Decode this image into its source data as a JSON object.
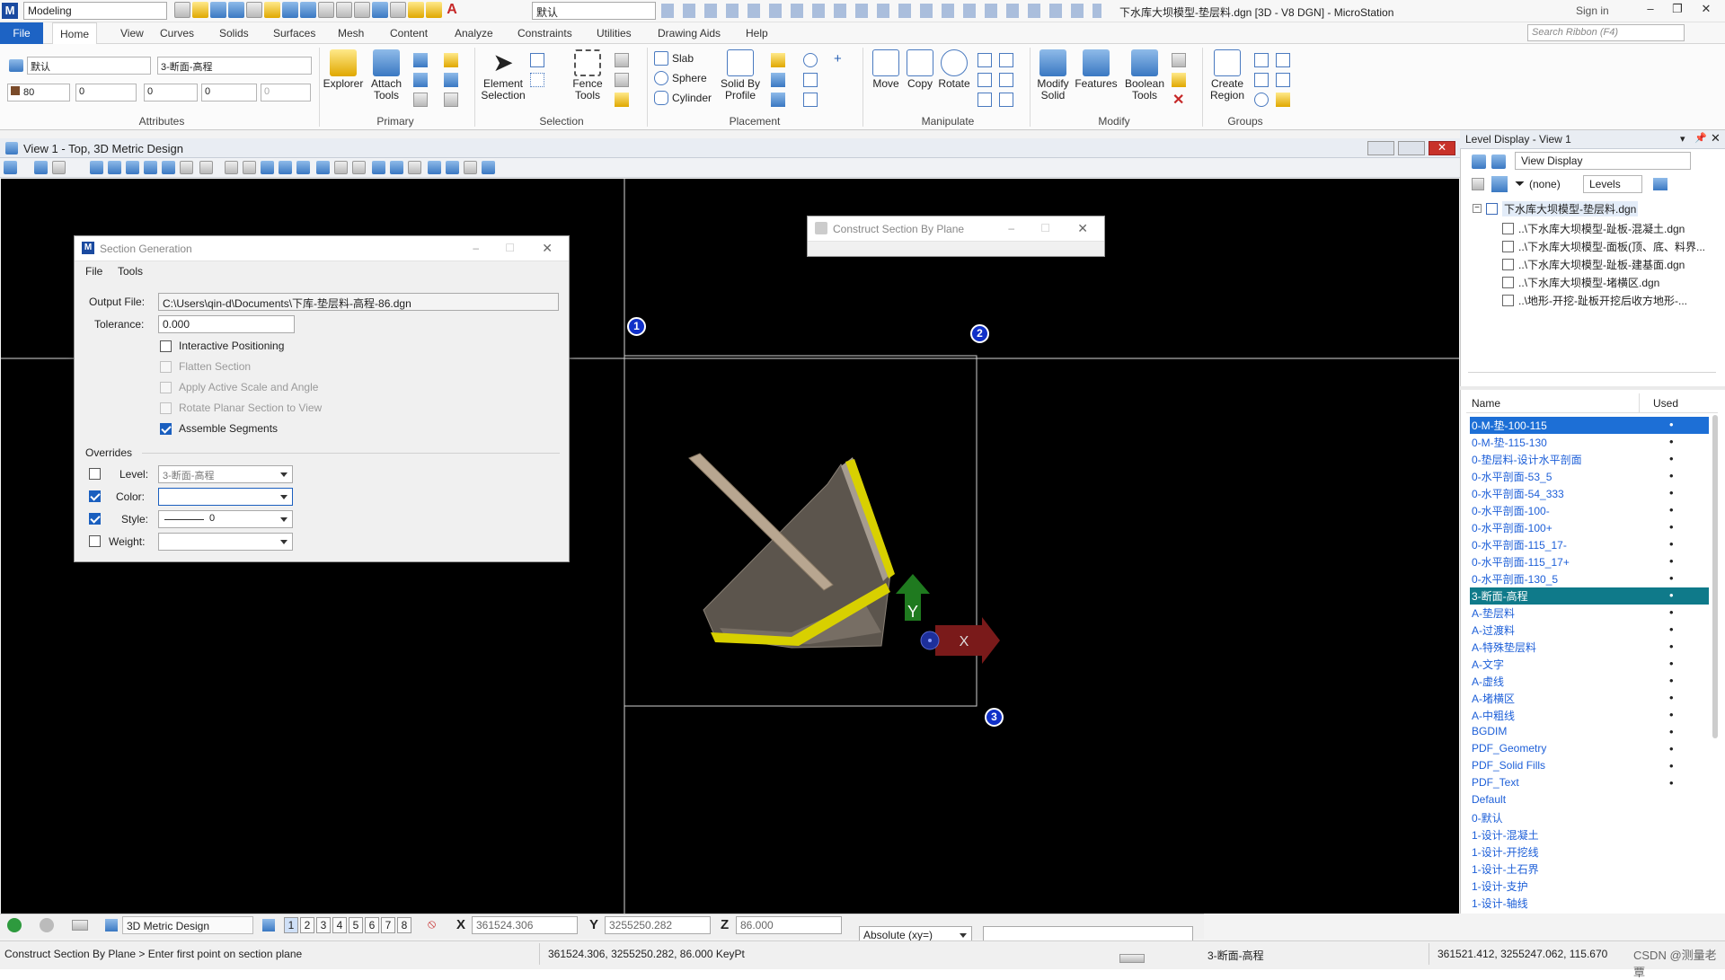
{
  "app": {
    "workspace": "Modeling",
    "active_style": "默认",
    "title": "下水库大坝模型-垫层料.dgn [3D - V8 DGN] - MicroStation",
    "signin": "Sign in"
  },
  "ribbon": {
    "tabs": [
      "File",
      "Home",
      "View",
      "Curves",
      "Solids",
      "Surfaces",
      "Mesh",
      "Content",
      "Analyze",
      "Constraints",
      "Utilities",
      "Drawing Aids",
      "Help"
    ],
    "search_placeholder": "Search Ribbon (F4)",
    "attributes": {
      "style": "默认",
      "level": "3-断面-高程",
      "color": "80",
      "weight": "0",
      "linestyle": "0",
      "transparency": "0",
      "priority": "0",
      "label": "Attributes"
    },
    "primary": {
      "explorer": "Explorer",
      "attach_tools": "Attach Tools",
      "label": "Primary"
    },
    "selection": {
      "element_selection": "Element Selection",
      "fence_tools": "Fence Tools",
      "label": "Selection"
    },
    "placement": {
      "slab": "Slab",
      "sphere": "Sphere",
      "cylinder": "Cylinder",
      "solid_by_profile": "Solid By Profile",
      "label": "Placement"
    },
    "manipulate": {
      "move": "Move",
      "copy": "Copy",
      "rotate": "Rotate",
      "label": "Manipulate"
    },
    "modify": {
      "modify_solid": "Modify Solid",
      "features": "Features",
      "boolean_tools": "Boolean Tools",
      "label": "Modify"
    },
    "groups": {
      "create_region": "Create Region",
      "label": "Groups"
    }
  },
  "view": {
    "title": "View 1 - Top, 3D Metric Design"
  },
  "section_dialog": {
    "title": "Section Generation",
    "menu": [
      "File",
      "Tools"
    ],
    "output_file_label": "Output File:",
    "output_file": "C:\\Users\\qin-d\\Documents\\下库-垫层料-高程-86.dgn",
    "tolerance_label": "Tolerance:",
    "tolerance": "0.000",
    "options": [
      {
        "label": "Interactive Positioning",
        "checked": false,
        "enabled": true
      },
      {
        "label": "Flatten Section",
        "checked": false,
        "enabled": false
      },
      {
        "label": "Apply Active Scale and Angle",
        "checked": false,
        "enabled": false
      },
      {
        "label": "Rotate Planar Section to View",
        "checked": false,
        "enabled": false
      },
      {
        "label": "Assemble Segments",
        "checked": true,
        "enabled": true
      }
    ],
    "overrides_label": "Overrides",
    "overrides": {
      "level_label": "Level:",
      "level_value": "3-断面-高程",
      "level_checked": false,
      "color_label": "Color:",
      "color_value": "",
      "color_checked": true,
      "style_label": "Style:",
      "style_value": "0",
      "style_checked": true,
      "weight_label": "Weight:",
      "weight_value": "",
      "weight_checked": false
    }
  },
  "construct_dialog": {
    "title": "Construct Section By Plane"
  },
  "points": [
    "1",
    "2",
    "3"
  ],
  "level_display": {
    "title": "Level Display - View 1",
    "view_display": "View Display",
    "filter": "(none)",
    "levels_btn": "Levels",
    "tree": [
      "下水库大坝模型-垫层料.dgn",
      "..\\下水库大坝模型-趾板-混凝土.dgn",
      "..\\下水库大坝模型-面板(顶、底、料界...",
      "..\\下水库大坝模型-趾板-建基面.dgn",
      "..\\下水库大坝模型-堵横区.dgn",
      "..\\地形-开挖-趾板开挖后收方地形-..."
    ],
    "col_name": "Name",
    "col_used": "Used",
    "levels": [
      {
        "name": "0-M-垫-100-115",
        "used": true,
        "state": "sel1"
      },
      {
        "name": "0-M-垫-115-130",
        "used": true,
        "state": ""
      },
      {
        "name": "0-垫层料-设计水平剖面",
        "used": true,
        "state": ""
      },
      {
        "name": "0-水平剖面-53_5",
        "used": true,
        "state": ""
      },
      {
        "name": "0-水平剖面-54_333",
        "used": true,
        "state": ""
      },
      {
        "name": "0-水平剖面-100-",
        "used": true,
        "state": ""
      },
      {
        "name": "0-水平剖面-100+",
        "used": true,
        "state": ""
      },
      {
        "name": "0-水平剖面-115_17-",
        "used": true,
        "state": ""
      },
      {
        "name": "0-水平剖面-115_17+",
        "used": true,
        "state": ""
      },
      {
        "name": "0-水平剖面-130_5",
        "used": true,
        "state": ""
      },
      {
        "name": "3-断面-高程",
        "used": true,
        "state": "sel2"
      },
      {
        "name": "A-垫层料",
        "used": true,
        "state": ""
      },
      {
        "name": "A-过渡料",
        "used": true,
        "state": ""
      },
      {
        "name": "A-特殊垫层料",
        "used": true,
        "state": ""
      },
      {
        "name": "A-文字",
        "used": true,
        "state": ""
      },
      {
        "name": "A-虚线",
        "used": true,
        "state": ""
      },
      {
        "name": "A-堵横区",
        "used": true,
        "state": ""
      },
      {
        "name": "A-中粗线",
        "used": true,
        "state": ""
      },
      {
        "name": "BGDIM",
        "used": true,
        "state": ""
      },
      {
        "name": "PDF_Geometry",
        "used": true,
        "state": ""
      },
      {
        "name": "PDF_Solid Fills",
        "used": true,
        "state": ""
      },
      {
        "name": "PDF_Text",
        "used": true,
        "state": ""
      },
      {
        "name": "Default",
        "used": false,
        "state": ""
      },
      {
        "name": "0-默认",
        "used": false,
        "state": ""
      },
      {
        "name": "1-设计-混凝土",
        "used": false,
        "state": ""
      },
      {
        "name": "1-设计-开挖线",
        "used": false,
        "state": ""
      },
      {
        "name": "1-设计-土石界",
        "used": false,
        "state": ""
      },
      {
        "name": "1-设计-支护",
        "used": false,
        "state": ""
      },
      {
        "name": "1-设计-轴线",
        "used": false,
        "state": ""
      }
    ]
  },
  "status_toolbar": {
    "model": "3D Metric Design",
    "views": [
      "1",
      "2",
      "3",
      "4",
      "5",
      "6",
      "7",
      "8"
    ],
    "x_label": "X",
    "x_value": "361524.306",
    "y_label": "Y",
    "y_value": "3255250.282",
    "z_label": "Z",
    "z_value": "86.000",
    "coord_mode": "Absolute (xy=)"
  },
  "status_bar": {
    "prompt": "Construct Section By Plane > Enter first point on section plane",
    "keypoint": "361524.306, 3255250.282, 86.000 KeyPt",
    "level": "3-断面-高程",
    "coords": "361521.412, 3255247.062, 115.670",
    "watermark": "CSDN @测量老覃"
  },
  "colors": {
    "file_tab": "#1d63c4",
    "level_selected": "#1d6fd6",
    "level_active": "#0f7a8a",
    "level_text": "#1d5fd8",
    "canvas": "#000000"
  }
}
